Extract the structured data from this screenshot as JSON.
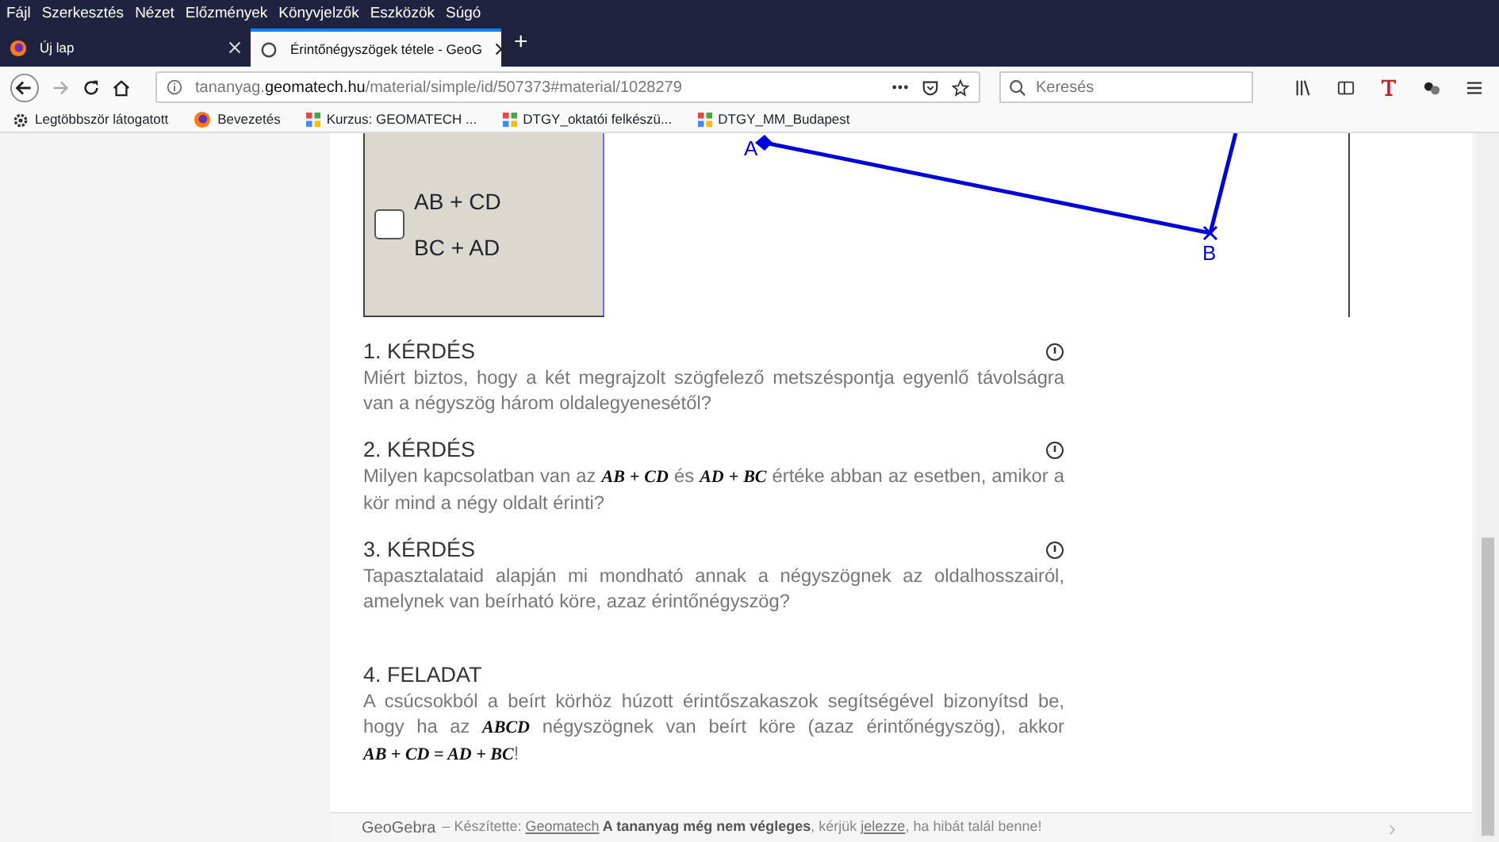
{
  "menu": [
    "Fájl",
    "Szerkesztés",
    "Nézet",
    "Előzmények",
    "Könyvjelzők",
    "Eszközök",
    "Súgó"
  ],
  "tabs": [
    {
      "label": "Új lap",
      "selected": false,
      "kind": "firefox"
    },
    {
      "label": "Érintőnégyszögek tétele - GeoG",
      "selected": true,
      "kind": "loading"
    }
  ],
  "new_tab": "+",
  "address": {
    "url": "tananyag.**geomatech.hu**/material/simple/id/507373#material/1028279"
  },
  "search": {
    "placeholder": "Keresés"
  },
  "bookmarks": [
    {
      "label": "Legtöbbször látogatott",
      "kind": "gear"
    },
    {
      "label": "Bevezetés",
      "kind": "firefox"
    },
    {
      "label": "Kurzus: GEOMATECH ...",
      "kind": "grid"
    },
    {
      "label": "DTGY_oktatói felkészü...",
      "kind": "grid"
    },
    {
      "label": "DTGY_MM_Budapest",
      "kind": "grid"
    }
  ],
  "applet": {
    "checkbox": {
      "checked": false
    },
    "labels": [
      "AB + CD",
      "BC + AD"
    ],
    "points": [
      "A",
      "B"
    ]
  },
  "sections": [
    {
      "title": "1. KÉRDÉS",
      "info": true,
      "text": "Miért biztos, hogy a két megrajzolt szögfelező metszéspontja egyenlő távolságra van a négyszög három oldalegyenesétől?"
    },
    {
      "title": "2. KÉRDÉS",
      "info": true,
      "text": "Milyen kapcsolatban van az *AB + CD* és *AD + BC* értéke abban az esetben, amikor a kör mind a négy oldalt érinti?"
    },
    {
      "title": "3. KÉRDÉS",
      "info": true,
      "text": "Tapasztalataid alapján mi mondható annak a négyszögnek az oldalhosszairól, amelynek van beírható köre, azaz érintőnégyszög?"
    },
    {
      "title": "4. FELADAT",
      "info": false,
      "text": "A csúcsokból a beírt körhöz húzott érintőszakaszok segítségével bizonyítsd be, hogy ha az *ABCD* négyszögnek van beírt köre (azaz érintőnégyszög), akkor *AB + CD = AD + BC*!"
    }
  ],
  "footer": {
    "logo": "GeoGebra",
    "parts": [
      {
        "kind": "text",
        "text": "– Készítette: "
      },
      {
        "kind": "link",
        "text": "Geomatech"
      },
      {
        "kind": "bold",
        "text": " A tananyag még nem végleges"
      },
      {
        "kind": "text",
        "text": ", kérjük "
      },
      {
        "kind": "link",
        "text": "jelezze"
      },
      {
        "kind": "text",
        "text": ", ha hibát talál benne!"
      }
    ],
    "next": "›"
  }
}
